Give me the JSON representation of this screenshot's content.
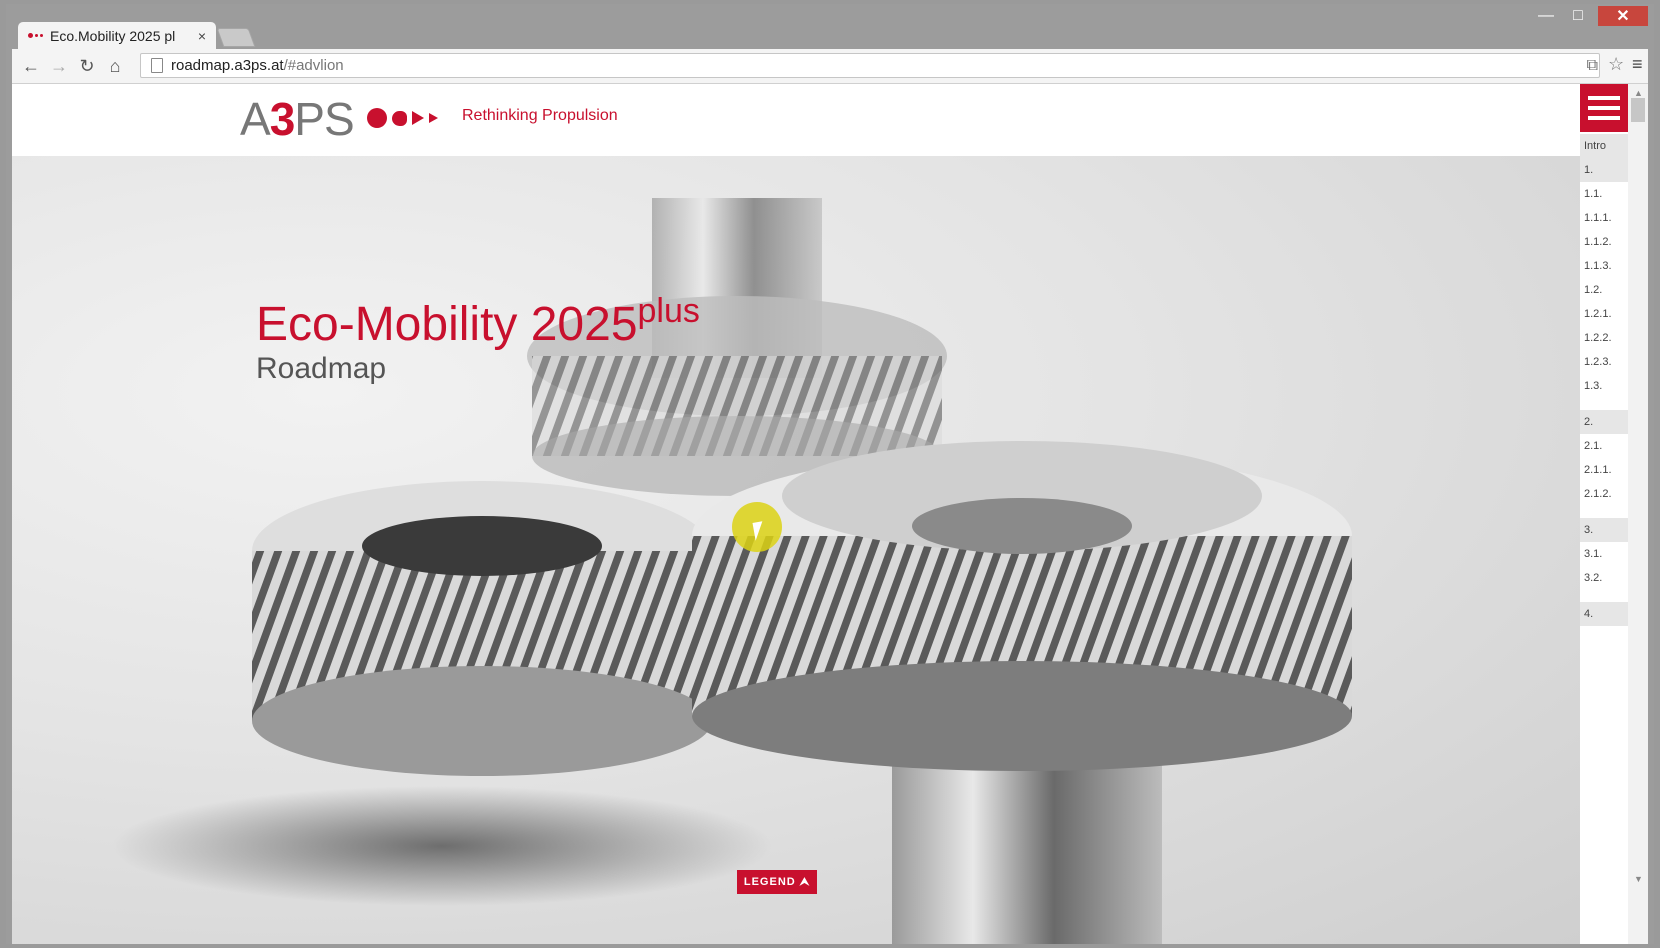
{
  "browser": {
    "tab_title": "Eco.Mobility 2025 pl",
    "tab_close": "×",
    "url_host": "roadmap.a3ps.at",
    "url_path": "/#advlion",
    "icons": {
      "back": "←",
      "forward": "→",
      "reload": "↻",
      "home": "⌂",
      "translate": "⧉",
      "star": "☆",
      "menu": "≡",
      "minimize": "—",
      "maximize": "□",
      "close": "✕"
    }
  },
  "site": {
    "logo_a": "A",
    "logo_3": "3",
    "logo_ps": "PS",
    "tagline": "Rethinking Propulsion",
    "accent_color": "#c8102e"
  },
  "hero": {
    "title": "Eco-Mobility 2025",
    "title_sup": "plus",
    "subtitle": "Roadmap"
  },
  "legend_button": "LEGEND ⮝",
  "side_nav": {
    "items": [
      {
        "label": "Intro",
        "grey": true
      },
      {
        "label": "1.",
        "grey": true
      },
      {
        "label": "1.1.",
        "grey": false
      },
      {
        "label": "1.1.1.",
        "grey": false
      },
      {
        "label": "1.1.2.",
        "grey": false
      },
      {
        "label": "1.1.3.",
        "grey": false
      },
      {
        "label": "1.2.",
        "grey": false
      },
      {
        "label": "1.2.1.",
        "grey": false
      },
      {
        "label": "1.2.2.",
        "grey": false
      },
      {
        "label": "1.2.3.",
        "grey": false
      },
      {
        "label": "1.3.",
        "grey": false
      },
      {
        "label": "2.",
        "grey": true,
        "gap": true
      },
      {
        "label": "2.1.",
        "grey": false
      },
      {
        "label": "2.1.1.",
        "grey": false
      },
      {
        "label": "2.1.2.",
        "grey": false
      },
      {
        "label": "3.",
        "grey": true,
        "gap": true
      },
      {
        "label": "3.1.",
        "grey": false
      },
      {
        "label": "3.2.",
        "grey": false
      },
      {
        "label": "4.",
        "grey": true,
        "gap": true
      }
    ]
  }
}
